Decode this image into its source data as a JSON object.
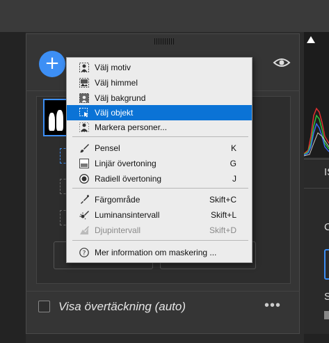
{
  "panel": {
    "add_symbol": "+",
    "overlay_label": "Visa övertäckning (auto)",
    "more_symbol": "•••"
  },
  "right": {
    "is_text": "IS",
    "c_text": "C",
    "s_text": "S"
  },
  "menu": {
    "groups": [
      [
        {
          "label": "Välj motiv",
          "icon": "subject-icon"
        },
        {
          "label": "Välj himmel",
          "icon": "sky-icon"
        },
        {
          "label": "Välj bakgrund",
          "icon": "background-icon"
        },
        {
          "label": "Välj objekt",
          "icon": "object-icon",
          "selected": true
        },
        {
          "label": "Markera personer...",
          "icon": "people-icon"
        }
      ],
      [
        {
          "label": "Pensel",
          "icon": "brush-icon",
          "shortcut": "K"
        },
        {
          "label": "Linjär övertoning",
          "icon": "linear-gradient-icon",
          "shortcut": "G"
        },
        {
          "label": "Radiell övertoning",
          "icon": "radial-gradient-icon",
          "shortcut": "J"
        }
      ],
      [
        {
          "label": "Färgområde",
          "icon": "color-range-icon",
          "shortcut": "Skift+C"
        },
        {
          "label": "Luminansintervall",
          "icon": "luminance-range-icon",
          "shortcut": "Skift+L"
        },
        {
          "label": "Djupintervall",
          "icon": "depth-range-icon",
          "shortcut": "Skift+D",
          "disabled": true
        }
      ],
      [
        {
          "label": "Mer information om maskering ...",
          "icon": "help-icon"
        }
      ]
    ]
  },
  "colors": {
    "accent": "#3d8ff5",
    "selection": "#0b73d6",
    "menu_bg": "#ececec",
    "panel_bg": "#353535"
  }
}
